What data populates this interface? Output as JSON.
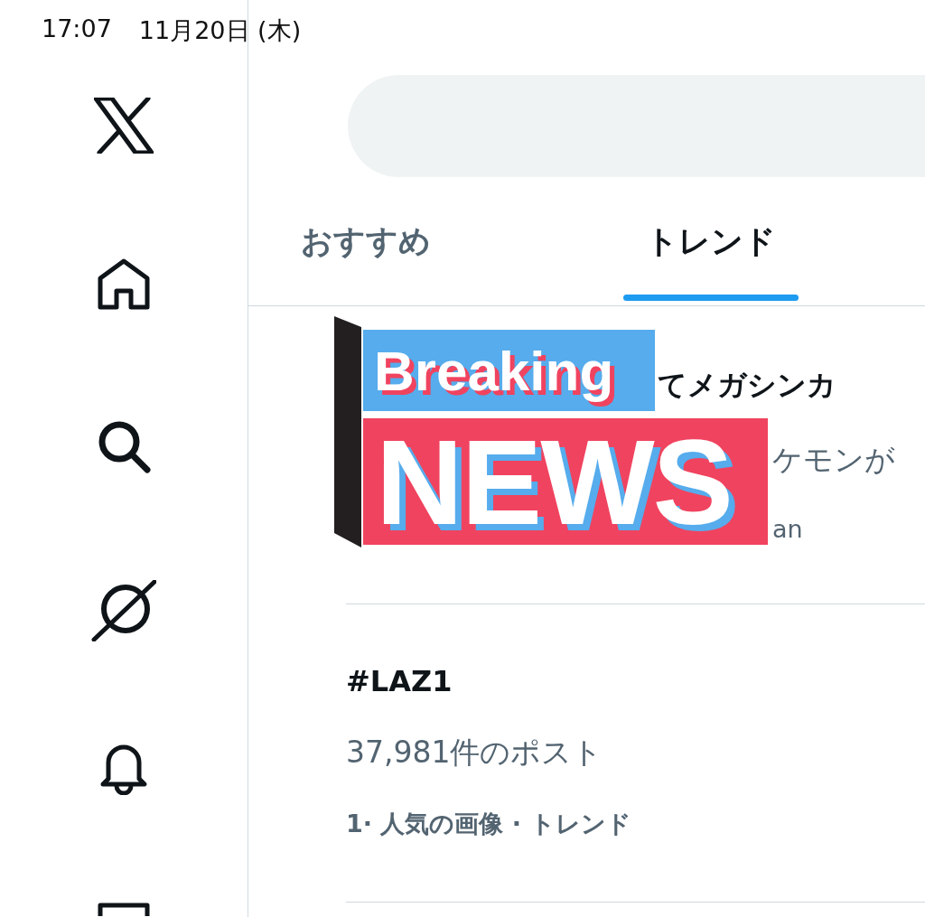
{
  "status_bar": {
    "time": "17:07",
    "date": "11月20日 (木)"
  },
  "sidebar": {
    "items": [
      {
        "kind": "x"
      },
      {
        "kind": "home"
      },
      {
        "kind": "search"
      },
      {
        "kind": "grok"
      },
      {
        "kind": "bell"
      },
      {
        "kind": "partial"
      }
    ]
  },
  "tabs": [
    {
      "label": "おすすめ",
      "selected": false
    },
    {
      "label": "トレンド",
      "selected": true
    }
  ],
  "trends": [
    {
      "kind": "covered",
      "title": "てメガシンカ",
      "count": "ケモンが",
      "meta": "an"
    },
    {
      "kind": "trend",
      "title": "#LAZ1",
      "count": "37,981件のポスト",
      "meta": "1· 人気の画像 · トレンド"
    }
  ],
  "sticker": {
    "top": "Breaking",
    "bottom": "NEWS"
  }
}
